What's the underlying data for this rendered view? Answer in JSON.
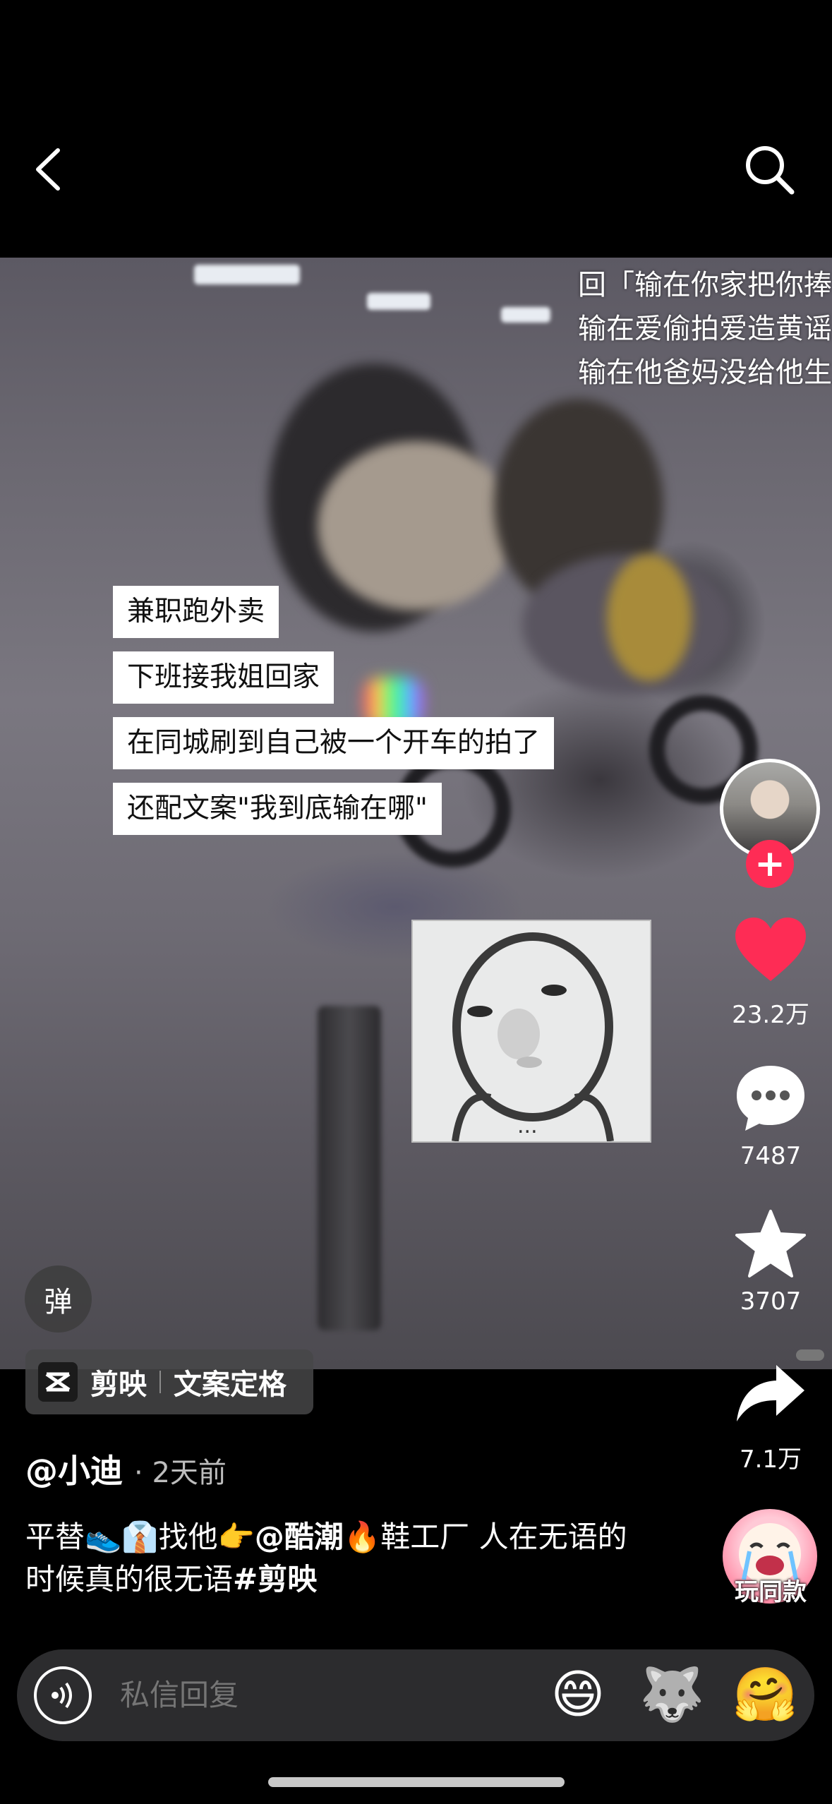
{
  "nav": {
    "back_icon": "chevron-left-icon",
    "search_icon": "search-icon"
  },
  "video": {
    "top_caption": [
      "回「输在你家把你捧",
      "输在爱偷拍爱造黄谣",
      "输在他爸妈没给他生"
    ],
    "labels": [
      "兼职跑外卖",
      "下班接我姐回家",
      "在同城刷到自己被一个开车的拍了",
      "还配文案\"我到底输在哪\""
    ],
    "meme_text": "...",
    "danmaku_label": "弹"
  },
  "actions": {
    "likes": "23.2万",
    "comments": "7487",
    "favorites": "3707",
    "shares": "7.1万",
    "like_color": "#fe2c55"
  },
  "capcut_tag": {
    "app": "剪映",
    "feature": "文案定格"
  },
  "post": {
    "author": "@小迪",
    "time": "· 2天前",
    "desc_a": "平替",
    "desc_b": "找他",
    "desc_mention": "@酷潮",
    "desc_c": "鞋工厂 人在无语的时候真的很无语",
    "desc_tag": "#剪映"
  },
  "same_style": {
    "label": "玩同款"
  },
  "reply": {
    "placeholder": "私信回复",
    "emojis": [
      "😄",
      "🐺",
      "🤗"
    ]
  }
}
